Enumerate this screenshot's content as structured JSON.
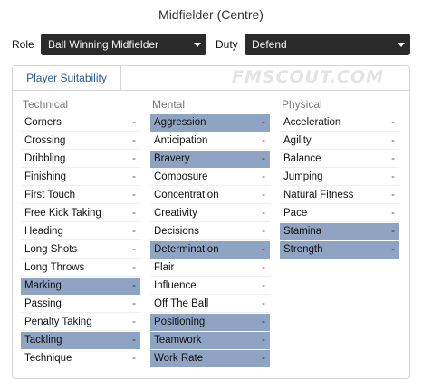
{
  "title": "Midfielder (Centre)",
  "role": {
    "label": "Role",
    "value": "Ball Winning Midfielder"
  },
  "duty": {
    "label": "Duty",
    "value": "Defend"
  },
  "tab": {
    "label": "Player Suitability"
  },
  "watermark": "FMSCOUT.COM",
  "columns": [
    {
      "header": "Technical",
      "items": [
        {
          "label": "Corners",
          "value": "-",
          "highlighted": false
        },
        {
          "label": "Crossing",
          "value": "-",
          "highlighted": false
        },
        {
          "label": "Dribbling",
          "value": "-",
          "highlighted": false
        },
        {
          "label": "Finishing",
          "value": "-",
          "highlighted": false
        },
        {
          "label": "First Touch",
          "value": "-",
          "highlighted": false
        },
        {
          "label": "Free Kick Taking",
          "value": "-",
          "highlighted": false
        },
        {
          "label": "Heading",
          "value": "-",
          "highlighted": false
        },
        {
          "label": "Long Shots",
          "value": "-",
          "highlighted": false
        },
        {
          "label": "Long Throws",
          "value": "-",
          "highlighted": false
        },
        {
          "label": "Marking",
          "value": "-",
          "highlighted": true
        },
        {
          "label": "Passing",
          "value": "-",
          "highlighted": false
        },
        {
          "label": "Penalty Taking",
          "value": "-",
          "highlighted": false
        },
        {
          "label": "Tackling",
          "value": "-",
          "highlighted": true
        },
        {
          "label": "Technique",
          "value": "-",
          "highlighted": false
        }
      ]
    },
    {
      "header": "Mental",
      "items": [
        {
          "label": "Aggression",
          "value": "-",
          "highlighted": true
        },
        {
          "label": "Anticipation",
          "value": "-",
          "highlighted": false
        },
        {
          "label": "Bravery",
          "value": "-",
          "highlighted": true
        },
        {
          "label": "Composure",
          "value": "-",
          "highlighted": false
        },
        {
          "label": "Concentration",
          "value": "-",
          "highlighted": false
        },
        {
          "label": "Creativity",
          "value": "-",
          "highlighted": false
        },
        {
          "label": "Decisions",
          "value": "-",
          "highlighted": false
        },
        {
          "label": "Determination",
          "value": "-",
          "highlighted": true
        },
        {
          "label": "Flair",
          "value": "-",
          "highlighted": false
        },
        {
          "label": "Influence",
          "value": "-",
          "highlighted": false
        },
        {
          "label": "Off The Ball",
          "value": "-",
          "highlighted": false
        },
        {
          "label": "Positioning",
          "value": "-",
          "highlighted": true
        },
        {
          "label": "Teamwork",
          "value": "-",
          "highlighted": true
        },
        {
          "label": "Work Rate",
          "value": "-",
          "highlighted": true
        }
      ]
    },
    {
      "header": "Physical",
      "items": [
        {
          "label": "Acceleration",
          "value": "-",
          "highlighted": false
        },
        {
          "label": "Agility",
          "value": "-",
          "highlighted": false
        },
        {
          "label": "Balance",
          "value": "-",
          "highlighted": false
        },
        {
          "label": "Jumping",
          "value": "-",
          "highlighted": false
        },
        {
          "label": "Natural Fitness",
          "value": "-",
          "highlighted": false
        },
        {
          "label": "Pace",
          "value": "-",
          "highlighted": false
        },
        {
          "label": "Stamina",
          "value": "-",
          "highlighted": true
        },
        {
          "label": "Strength",
          "value": "-",
          "highlighted": true
        }
      ]
    }
  ],
  "colors": {
    "highlight": "#8fa3c2",
    "dropdown_bg": "#2b2b2b",
    "tab_text": "#2a5d8c"
  }
}
